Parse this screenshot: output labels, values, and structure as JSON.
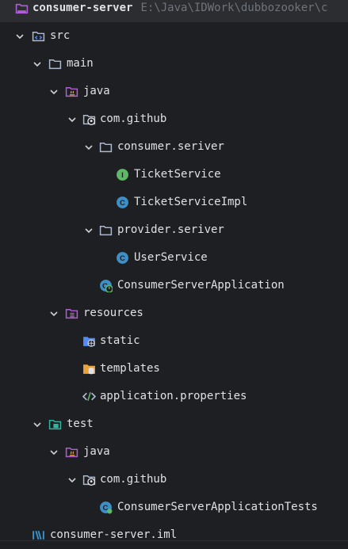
{
  "project_tree": {
    "root": {
      "label": "consumer-server",
      "path": "E:\\Java\\IDWork\\dubbozooker\\c"
    },
    "src": "src",
    "main": "main",
    "main_java": "java",
    "main_package": "com.github",
    "consumer_package": "consumer.seriver",
    "ticket_service": "TicketService",
    "ticket_service_impl": "TicketServiceImpl",
    "provider_package": "provider.seriver",
    "user_service": "UserService",
    "app_class": "ConsumerServerApplication",
    "resources": "resources",
    "static": "static",
    "templates": "templates",
    "app_properties": "application.properties",
    "test": "test",
    "test_java": "java",
    "test_package": "com.github",
    "app_tests": "ConsumerServerApplicationTests",
    "iml_file": "consumer-server.iml"
  },
  "colors": {
    "background": "#1e1f22",
    "text": "#dfe1e5",
    "hint": "#6f737a",
    "folder": "#aeb9d0",
    "source_folder": "#548af7",
    "resource_folder": "#b15ed6",
    "test_folder": "#2fb4a0",
    "interface_icon": "#5fb865",
    "class_icon": "#3d8fc7"
  },
  "icons": {
    "chevron": "chevron-down-icon",
    "module": "module-folder-icon",
    "source_root": "source-root-folder-icon",
    "folder": "folder-icon",
    "java_source": "java-source-folder-icon",
    "package": "package-github-icon",
    "interface": "interface-icon",
    "class": "class-icon",
    "spring_app": "spring-boot-class-icon",
    "resources_root": "resources-root-folder-icon",
    "web_folder": "web-folder-icon",
    "templates_folder": "templates-folder-icon",
    "properties": "properties-file-icon",
    "test_root": "test-root-folder-icon",
    "iml": "iml-file-icon"
  }
}
